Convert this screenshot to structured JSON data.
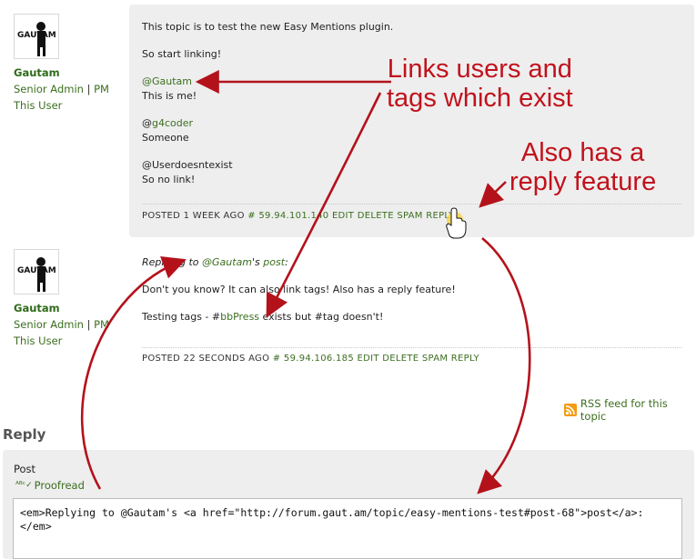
{
  "posts": [
    {
      "author": {
        "name": "Gautam",
        "role": "Senior Admin",
        "pm": "PM",
        "this_user": "This User",
        "avatar_text": "GAUTAM"
      },
      "lines": {
        "intro": "This topic is to test the new Easy Mentions plugin.",
        "start": "So start linking!",
        "mention1": "@Gautam",
        "mention1_text": "This is me!",
        "mention2_prefix": "@",
        "mention2_link": "g4coder",
        "mention2_text": "Someone",
        "mention3": "@Userdoesntexist",
        "mention3_text": "So no link!"
      },
      "meta": {
        "posted": "POSTED 1 WEEK AGO",
        "ip": "# 59.94.101.140",
        "edit": "EDIT",
        "delete": "DELETE",
        "spam": "SPAM",
        "reply": "REPLY"
      }
    },
    {
      "author": {
        "name": "Gautam",
        "role": "Senior Admin",
        "pm": "PM",
        "this_user": "This User",
        "avatar_text": "GAUTAM"
      },
      "lines": {
        "replying_prefix": "Replying to ",
        "replying_link": "@Gautam",
        "replying_middle": "'s ",
        "replying_post": "post",
        "replying_suffix": ":",
        "body1": "Don't you know? It can also link tags! Also has a reply feature!",
        "tags_prefix": "Testing tags - #",
        "tags_link": "bbPress",
        "tags_suffix": " exists but #tag doesn't!"
      },
      "meta": {
        "posted": "POSTED 22 SECONDS AGO",
        "ip": "# 59.94.106.185",
        "edit": "EDIT",
        "delete": "DELETE",
        "spam": "SPAM",
        "reply": "REPLY"
      }
    }
  ],
  "annotations": {
    "links": "Links users and\ntags which exist",
    "reply": "Also has a\nreply feature"
  },
  "rss": {
    "label": "RSS feed for this topic",
    "icon": "rss-icon"
  },
  "reply_form": {
    "heading": "Reply",
    "post_label": "Post",
    "proofread": "Proofread",
    "textarea_value": "<em>Replying to @Gautam's <a href=\"http://forum.gaut.am/topic/easy-mentions-test#post-68\">post</a>:</em>"
  },
  "colors": {
    "link": "#3c6e1f",
    "annotation": "#c1121c",
    "post_bg": "#eeeeee"
  }
}
